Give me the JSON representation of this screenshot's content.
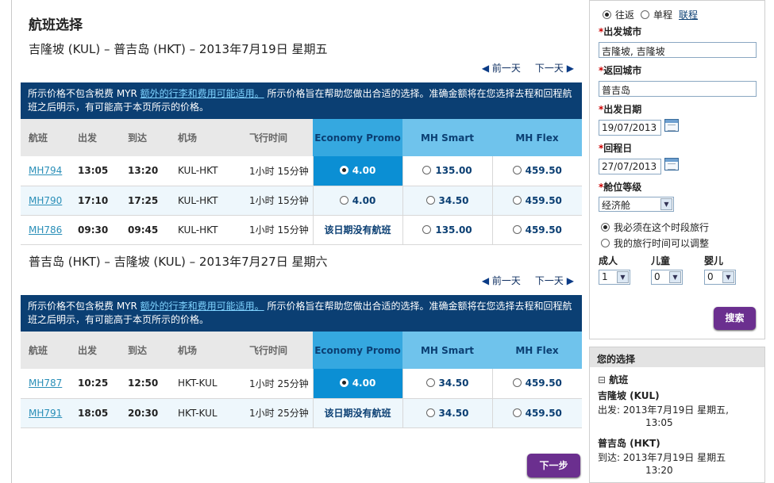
{
  "page_title": "航班选择",
  "notice": {
    "prefix": "所示价格不包含税费 MYR ",
    "link": "额外的行李和费用可能适用。",
    "suffix": " 所示价格旨在帮助您做出合适的选择。准确金额将在您选择去程和回程航班之后明示，有可能高于本页所示的价格。"
  },
  "day_nav": {
    "prev": "前一天",
    "next": "下一天"
  },
  "columns": {
    "flight": "航班",
    "depart": "出发",
    "arrive": "到达",
    "airport": "机场",
    "duration": "飞行时间",
    "fare1": "Economy Promo",
    "fare2": "MH Smart",
    "fare3": "MH Flex"
  },
  "outbound": {
    "title": "吉隆坡 (KUL) – 普吉岛 (HKT) – 2013年7月19日 星期五",
    "rows": [
      {
        "flight": "MH794",
        "depart": "13:05",
        "arrive": "13:20",
        "airport": "KUL-HKT",
        "duration": "1小时 15分钟",
        "fare1": "4.00",
        "fare2": "135.00",
        "fare3": "459.50"
      },
      {
        "flight": "MH790",
        "depart": "17:10",
        "arrive": "17:25",
        "airport": "KUL-HKT",
        "duration": "1小时 15分钟",
        "fare1": "4.00",
        "fare2": "34.50",
        "fare3": "459.50"
      },
      {
        "flight": "MH786",
        "depart": "09:30",
        "arrive": "09:45",
        "airport": "KUL-HKT",
        "duration": "1小时 15分钟",
        "fare1": "该日期没有航班",
        "fare2": "135.00",
        "fare3": "459.50"
      }
    ]
  },
  "return": {
    "title": "普吉岛 (HKT) – 吉隆坡 (KUL) – 2013年7月27日 星期六",
    "rows": [
      {
        "flight": "MH787",
        "depart": "10:25",
        "arrive": "12:50",
        "airport": "HKT-KUL",
        "duration": "1小时 25分钟",
        "fare1": "4.00",
        "fare2": "34.50",
        "fare3": "459.50"
      },
      {
        "flight": "MH791",
        "depart": "18:05",
        "arrive": "20:30",
        "airport": "HKT-KUL",
        "duration": "1小时 25分钟",
        "fare1": "该日期没有航班",
        "fare2": "34.50",
        "fare3": "459.50"
      }
    ]
  },
  "next_button": "下一步",
  "search": {
    "round_trip": "往返",
    "one_way": "单程",
    "multi_city": "联程",
    "from_label": "出发城市",
    "from_value": "吉隆坡, 吉隆坡",
    "to_label": "返回城市",
    "to_value": "普吉岛",
    "depart_label": "出发日期",
    "depart_value": "19/07/2013",
    "return_label": "回程日",
    "return_value": "27/07/2013",
    "class_label": "舱位等级",
    "class_value": "经济舱",
    "option_fixed": "我必须在这个时段旅行",
    "option_flexible": "我的旅行时间可以调整",
    "adult_label": "成人",
    "adult_value": "1",
    "child_label": "儿童",
    "child_value": "0",
    "infant_label": "婴儿",
    "infant_value": "0",
    "search_button": "搜索"
  },
  "your_choice": {
    "title": "您的选择",
    "section": "航班",
    "out_city": "吉隆坡 (KUL)",
    "out_line1": "出发: 2013年7月19日 星期五,",
    "out_line2": "13:05",
    "ret_city": "普吉岛 (HKT)",
    "ret_line1": "到达: 2013年7月19日 星期五",
    "ret_line2": "13:20"
  },
  "colors": {
    "notice_bg": "#0b3f73",
    "fare_header": "#6fc3ec",
    "selected": "#0b8fd4",
    "button": "#6b2f8f"
  }
}
